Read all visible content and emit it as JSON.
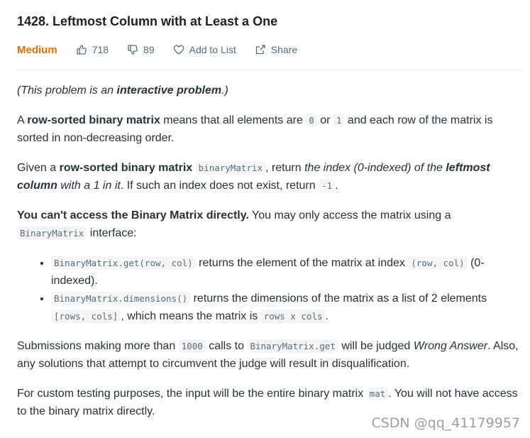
{
  "problem": {
    "title": "1428. Leftmost Column with at Least a One",
    "difficulty": "Medium",
    "likes": "718",
    "dislikes": "89",
    "add_to_list": "Add to List",
    "share": "Share"
  },
  "description": {
    "p1": {
      "open": "(This problem is an ",
      "bold": "interactive problem",
      "close": ".)"
    },
    "p2": {
      "a": "A ",
      "bold": "row-sorted binary matrix",
      "b": " means that all elements are ",
      "code1": "0",
      "c": " or ",
      "code2": "1",
      "d": " and each row of the matrix is sorted in non-decreasing order."
    },
    "p3": {
      "a": "Given a ",
      "bold": "row-sorted binary matrix",
      "code": "binaryMatrix",
      "b": ", return ",
      "italic": "the index (0-indexed) of the ",
      "bold_italic": "leftmost column",
      "italic2": " with a 1 in it",
      "c": ". If such an index does not exist, return ",
      "code2": "-1",
      "d": "."
    },
    "p4": {
      "bold": "You can't access the Binary Matrix directly.",
      "a": " You may only access the matrix using a ",
      "code": "BinaryMatrix",
      "b": " interface:"
    },
    "li1": {
      "code": "BinaryMatrix.get(row, col)",
      "a": " returns the element of the matrix at index ",
      "code2": "(row, col)",
      "b": " (0-indexed)."
    },
    "li2": {
      "code": "BinaryMatrix.dimensions()",
      "a": " returns the dimensions of the matrix as a list of 2 elements ",
      "code2": "[rows, cols]",
      "b": ", which means the matrix is ",
      "code3": "rows x cols",
      "c": "."
    },
    "p5": {
      "a": "Submissions making more than ",
      "code": "1000",
      "b": " calls to ",
      "code2": "BinaryMatrix.get",
      "c": " will be judged ",
      "italic": "Wrong Answer",
      "d": ". Also, any solutions that attempt to circumvent the judge will result in disqualification."
    },
    "p6": {
      "a": "For custom testing purposes, the input will be the entire binary matrix ",
      "code": "mat",
      "b": ". You will not have access to the binary matrix directly."
    }
  },
  "watermark": "CSDN @qq_41179957"
}
